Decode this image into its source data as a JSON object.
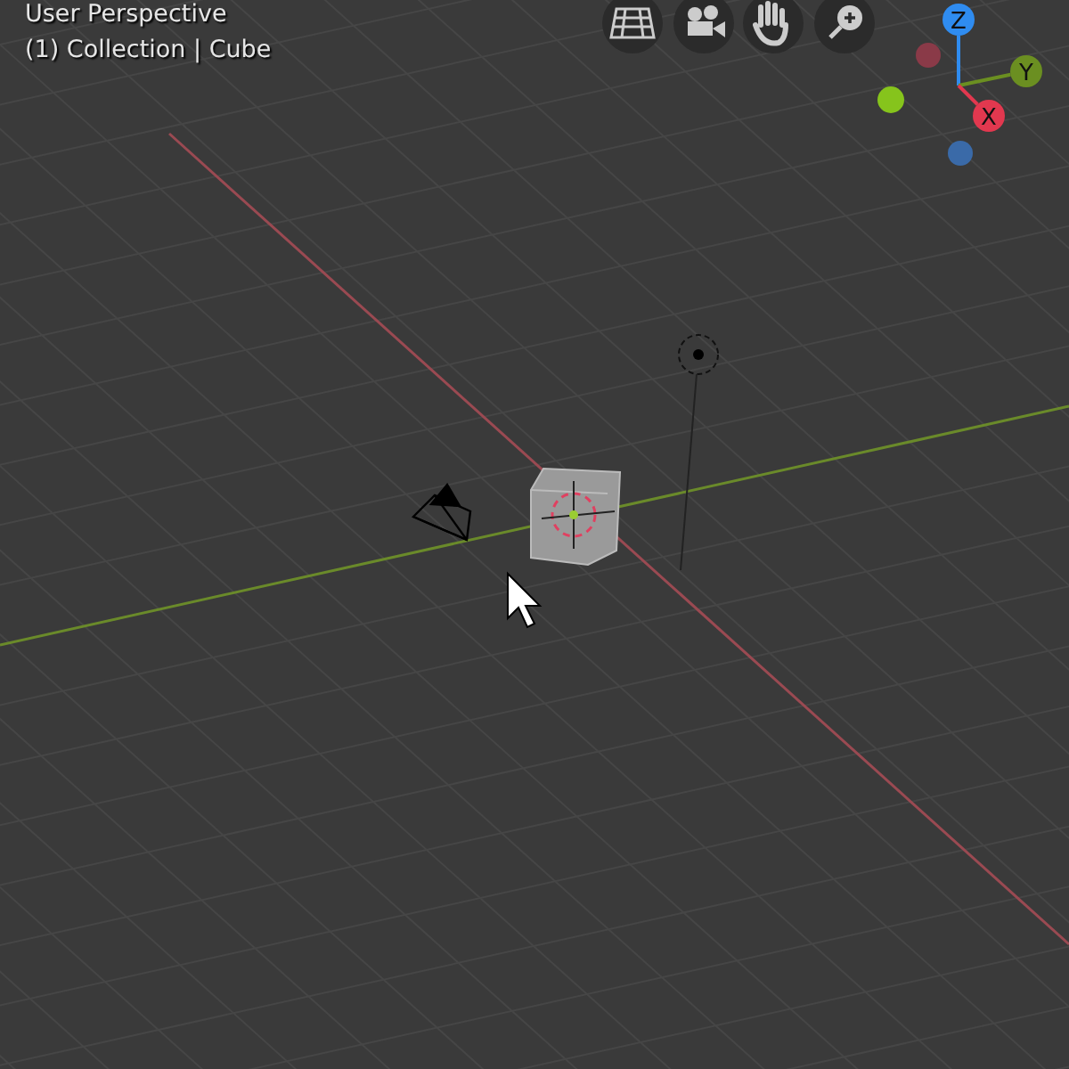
{
  "viewport": {
    "title": "User Perspective",
    "collection_label": "(1) Collection | Cube"
  },
  "gizmo": {
    "axes": [
      {
        "label": "Z",
        "color": "#2f8cf0"
      },
      {
        "label": "Y",
        "color": "#6b8f21"
      },
      {
        "label": "X",
        "color": "#e2384f"
      }
    ]
  }
}
